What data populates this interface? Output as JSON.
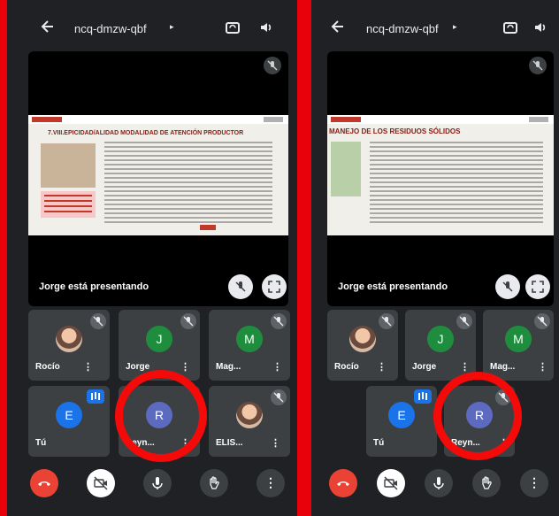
{
  "left": {
    "meeting_code": "ncq-dmzw-qbf",
    "presenting_text": "Jorge está presentando",
    "slide_title": "7.VIII.EPICIDAD/ALIDAD MODALIDAD DE ATENCIÓN PRODUCTOR",
    "participants": [
      {
        "name": "Rocío",
        "initial": "",
        "color": "#3c4043",
        "photo": true,
        "muted": true
      },
      {
        "name": "Jorge",
        "initial": "J",
        "color": "#1e8e3e",
        "photo": false,
        "muted": true
      },
      {
        "name": "Mag...",
        "initial": "M",
        "color": "#1e8e3e",
        "photo": false,
        "muted": true
      },
      {
        "name": "Tú",
        "initial": "E",
        "color": "#1a73e8",
        "photo": false,
        "muted": false,
        "speaking": true
      },
      {
        "name": "Reyn...",
        "initial": "R",
        "color": "#5c6bc0",
        "photo": false,
        "muted": true
      },
      {
        "name": "ELIS...",
        "initial": "",
        "color": "#3c4043",
        "photo": true,
        "muted": true
      }
    ]
  },
  "right": {
    "meeting_code": "ncq-dmzw-qbf",
    "presenting_text": "Jorge está presentando",
    "slide_title": "MANEJO DE LOS RESIDUOS SÓLIDOS",
    "participants": [
      {
        "name": "Rocío",
        "initial": "",
        "color": "#3c4043",
        "photo": true,
        "muted": true
      },
      {
        "name": "Jorge",
        "initial": "J",
        "color": "#1e8e3e",
        "photo": false,
        "muted": true
      },
      {
        "name": "Mag...",
        "initial": "M",
        "color": "#1e8e3e",
        "photo": false,
        "muted": true
      },
      {
        "name": "Tú",
        "initial": "E",
        "color": "#1a73e8",
        "photo": false,
        "muted": false,
        "speaking": true
      },
      {
        "name": "Reyn...",
        "initial": "R",
        "color": "#5c6bc0",
        "photo": false,
        "muted": true
      }
    ]
  },
  "icons": {
    "back": "arrow-left-icon",
    "switch_camera": "camera-switch-icon",
    "speaker": "speaker-icon",
    "end_call": "phone-hangup-icon",
    "camera_off": "camera-off-icon",
    "mic": "microphone-icon",
    "raise_hand": "hand-icon",
    "more": "more-vert-icon"
  },
  "colors": {
    "background": "#202124",
    "tile": "#3c4043",
    "highlight_ring": "#f50a0a",
    "end_call": "#ea4335"
  }
}
